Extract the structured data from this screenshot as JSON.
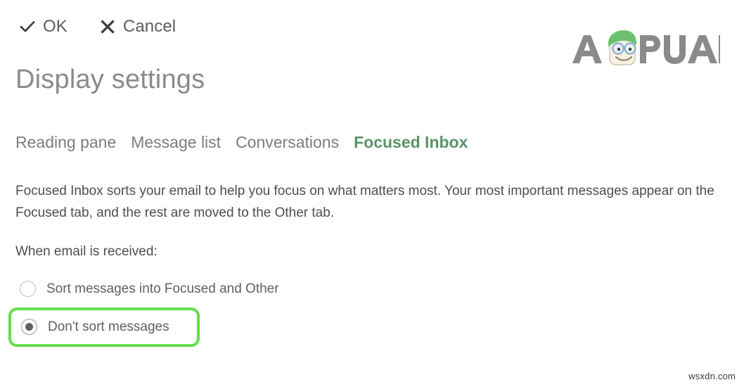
{
  "command_bar": {
    "ok": {
      "label": "OK",
      "icon": "checkmark-icon"
    },
    "cancel": {
      "label": "Cancel",
      "icon": "close-x-icon"
    }
  },
  "page_title": "Display settings",
  "tabs": [
    {
      "label": "Reading pane",
      "active": false
    },
    {
      "label": "Message list",
      "active": false
    },
    {
      "label": "Conversations",
      "active": false
    },
    {
      "label": "Focused Inbox",
      "active": true
    }
  ],
  "description": "Focused Inbox sorts your email to help you focus on what matters most. Your most important messages appear on the Focused tab, and the rest are moved to the Other tab.",
  "options": {
    "section_label": "When email is received:",
    "items": [
      {
        "label": "Sort messages into Focused and Other",
        "selected": false
      },
      {
        "label": "Don't sort messages",
        "selected": true
      }
    ]
  },
  "annotation": {
    "type": "highlight-rectangle",
    "target": "Don't sort messages",
    "color": "#66dd49"
  },
  "logo": {
    "text": "APPUALS",
    "hair_color": "#6cc16f",
    "text_color": "#8a8a8a"
  },
  "watermark": "wsxdn.com",
  "colors": {
    "background": "#ffffff",
    "active_tab": "#5a9468",
    "body_text": "#4e4e4e",
    "title_text": "#8a8a8a",
    "highlight_green": "#66dd49"
  }
}
